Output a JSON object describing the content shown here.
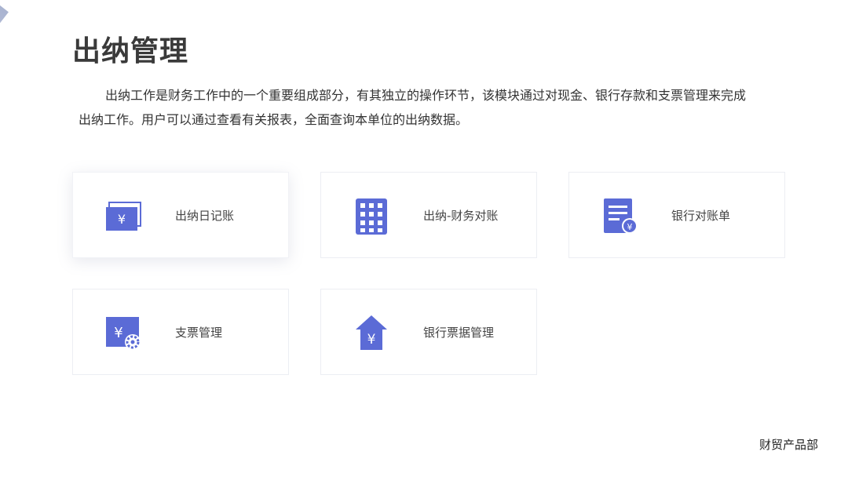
{
  "page": {
    "title": "出纳管理",
    "intro_line1": "出纳工作是财务工作中的一个重要组成部分，有其独立的操作环节，该模块通过对现金、银行存款和支票管理来完成",
    "intro_line2": "出纳工作。用户可以通过查看有关报表，全面查询本单位的出纳数据。"
  },
  "modules": [
    {
      "label": "出纳日记账",
      "icon": "cash-journal-icon"
    },
    {
      "label": "出纳-财务对账",
      "icon": "calculator-icon"
    },
    {
      "label": "银行对账单",
      "icon": "bank-statement-icon"
    },
    {
      "label": "支票管理",
      "icon": "check-settings-icon"
    },
    {
      "label": "银行票据管理",
      "icon": "bank-house-icon"
    }
  ],
  "footer": {
    "department": "财贸产品部"
  },
  "colors": {
    "accent": "#5b6bd6",
    "title": "#3a3a3a",
    "card_border": "#eceef3"
  }
}
